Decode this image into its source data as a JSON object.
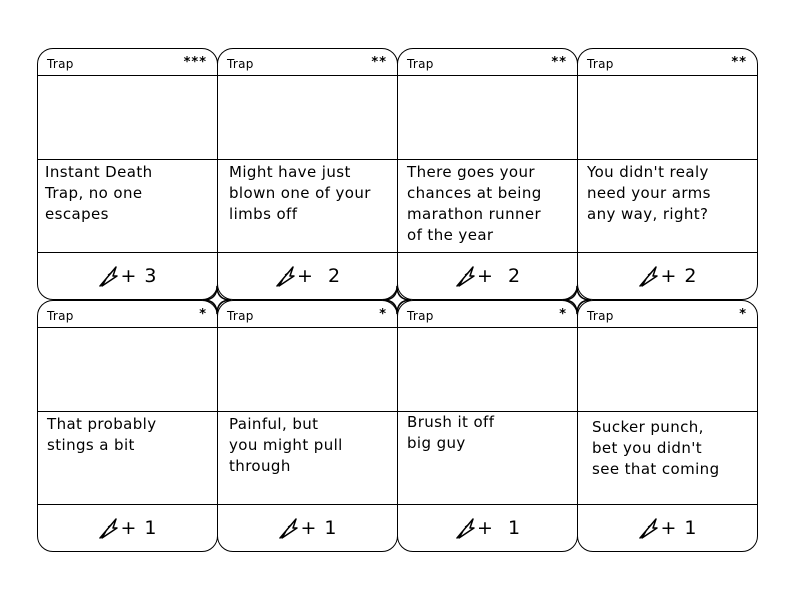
{
  "cards": [
    {
      "type": "Trap",
      "stars": "***",
      "text": "Instant Death\nTrap, no one\nescapes",
      "bonus": "+ 3",
      "blade_icon": "blade-icon"
    },
    {
      "type": "Trap",
      "stars": "**",
      "text": "Might have just\nblown one of your\nlimbs off",
      "bonus": "+  2",
      "blade_icon": "blade-icon"
    },
    {
      "type": "Trap",
      "stars": "**",
      "text": "There goes your\nchances at being\nmarathon runner\nof the year",
      "bonus": "+  2",
      "blade_icon": "blade-icon"
    },
    {
      "type": "Trap",
      "stars": "**",
      "text": "You didn't realy\nneed your arms\nany way, right?",
      "bonus": "+ 2",
      "blade_icon": "blade-icon"
    },
    {
      "type": "Trap",
      "stars": "*",
      "text": "That probably\nstings a bit",
      "bonus": "+ 1",
      "blade_icon": "blade-icon"
    },
    {
      "type": "Trap",
      "stars": "*",
      "text": "Painful, but\nyou might pull\nthrough",
      "bonus": "+ 1",
      "blade_icon": "blade-icon"
    },
    {
      "type": "Trap",
      "stars": "*",
      "text": "Brush it off\nbig guy",
      "bonus": "+  1",
      "blade_icon": "blade-icon"
    },
    {
      "type": "Trap",
      "stars": "*",
      "text": "Sucker punch,\nbet you didn't\nsee that coming",
      "bonus": "+ 1",
      "blade_icon": "blade-icon"
    }
  ]
}
